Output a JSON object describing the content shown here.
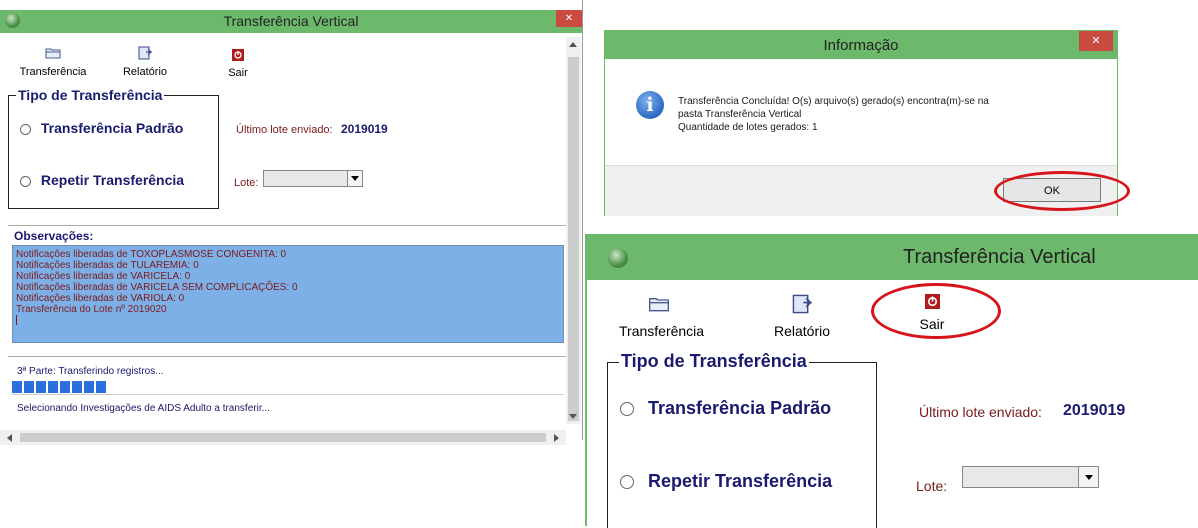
{
  "left_window": {
    "title": "Transferência Vertical",
    "close_glyph": "✕",
    "toolbar": {
      "transferencia": "Transferência",
      "relatorio": "Relatório",
      "sair": "Sair"
    },
    "tipo_group_label": "Tipo de Transferência",
    "option_padrao": "Transferência Padrão",
    "option_repetir": "Repetir Transferência",
    "selected_option": "Transferência Padrão",
    "ultimo_lote_label": "Último lote enviado:",
    "ultimo_lote_value": "2019019",
    "lote_label": "Lote:",
    "lote_value": "",
    "observacoes_label": "Observações:",
    "observacoes_lines": [
      "Notificações liberadas de TOXOPLASMOSE CONGENITA: 0",
      "Notificações liberadas de TULAREMIA: 0",
      "Notificações liberadas de VARICELA: 0",
      "Notificações liberadas de VARICELA SEM COMPLICAÇÕES: 0",
      "Notificações liberadas de VARIOLA: 0",
      "Transferência do Lote nº 2019020"
    ],
    "status_part": "3ª Parte: Transferindo registros...",
    "progress_fraction": 0.17,
    "status_detail": "Selecionando Investigações de AIDS Adulto a transferir..."
  },
  "dialog": {
    "title": "Informação",
    "close_glyph": "✕",
    "message_lines": [
      "Transferência Concluída! O(s) arquivo(s) gerado(s) encontra(m)-se na",
      "pasta Transferência Vertical",
      "Quantidade de lotes gerados: 1"
    ],
    "ok_label": "OK"
  },
  "right_window": {
    "title": "Transferência Vertical",
    "toolbar": {
      "transferencia": "Transferência",
      "relatorio": "Relatório",
      "sair": "Sair"
    },
    "tipo_group_label": "Tipo de Transferência",
    "option_padrao": "Transferência Padrão",
    "option_repetir": "Repetir Transferência",
    "selected_option": "Transferência Padrão",
    "ultimo_lote_label": "Último lote enviado:",
    "ultimo_lote_value": "2019019",
    "lote_label": "Lote:",
    "lote_value": ""
  },
  "colors": {
    "titlebar": "#6cb96c",
    "close_button": "#c94a3f",
    "observacoes_bg": "#7eb0e8",
    "observacoes_text": "#7a1a1a",
    "progress_block": "#2a6fdb",
    "highlight_oval": "#d8141b",
    "info_icon": "#2e6fc4"
  },
  "icons": {
    "app_icon": "app-globe-icon",
    "transferencia": "folder-icon",
    "relatorio": "report-icon",
    "sair": "power-icon",
    "info": "info-icon"
  }
}
